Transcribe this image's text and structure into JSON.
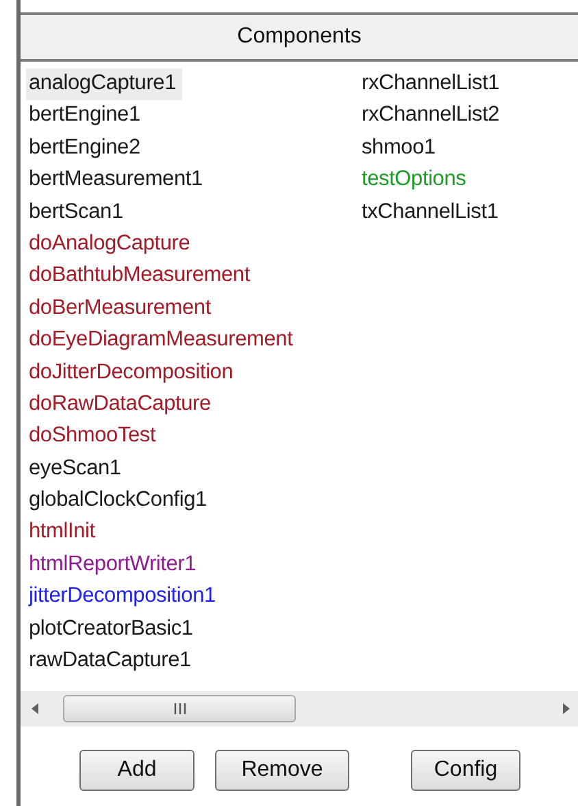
{
  "panel": {
    "title": "Components"
  },
  "components": [
    {
      "name": "analogCapture1",
      "color": "#1a1a1a",
      "selected": true
    },
    {
      "name": "bertEngine1",
      "color": "#1a1a1a",
      "selected": false
    },
    {
      "name": "bertEngine2",
      "color": "#1a1a1a",
      "selected": false
    },
    {
      "name": "bertMeasurement1",
      "color": "#1a1a1a",
      "selected": false
    },
    {
      "name": "bertScan1",
      "color": "#1a1a1a",
      "selected": false
    },
    {
      "name": "doAnalogCapture",
      "color": "#a01c28",
      "selected": false
    },
    {
      "name": "doBathtubMeasurement",
      "color": "#a01c28",
      "selected": false
    },
    {
      "name": "doBerMeasurement",
      "color": "#a01c28",
      "selected": false
    },
    {
      "name": "doEyeDiagramMeasurement",
      "color": "#a01c28",
      "selected": false
    },
    {
      "name": "doJitterDecomposition",
      "color": "#a01c28",
      "selected": false
    },
    {
      "name": "doRawDataCapture",
      "color": "#a01c28",
      "selected": false
    },
    {
      "name": "doShmooTest",
      "color": "#a01c28",
      "selected": false
    },
    {
      "name": "eyeScan1",
      "color": "#1a1a1a",
      "selected": false
    },
    {
      "name": "globalClockConfig1",
      "color": "#1a1a1a",
      "selected": false
    },
    {
      "name": "htmlInit",
      "color": "#a01c28",
      "selected": false
    },
    {
      "name": "htmlReportWriter1",
      "color": "#8e1c8e",
      "selected": false
    },
    {
      "name": "jitterDecomposition1",
      "color": "#2020ee",
      "selected": false
    },
    {
      "name": "plotCreatorBasic1",
      "color": "#1a1a1a",
      "selected": false
    },
    {
      "name": "rawDataCapture1",
      "color": "#1a1a1a",
      "selected": false
    },
    {
      "name": "rxChannelList1",
      "color": "#1a1a1a",
      "selected": false
    },
    {
      "name": "rxChannelList2",
      "color": "#1a1a1a",
      "selected": false
    },
    {
      "name": "shmoo1",
      "color": "#1a1a1a",
      "selected": false
    },
    {
      "name": "testOptions",
      "color": "#1e9a28",
      "selected": false
    },
    {
      "name": "txChannelList1",
      "color": "#1a1a1a",
      "selected": false
    }
  ],
  "buttons": [
    "Add",
    "Remove",
    "Config"
  ]
}
